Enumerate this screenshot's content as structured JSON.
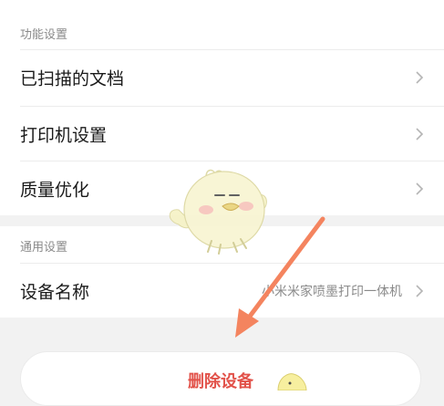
{
  "sections": {
    "function": {
      "title": "功能设置",
      "items": [
        {
          "label": "已扫描的文档"
        },
        {
          "label": "打印机设置"
        },
        {
          "label": "质量优化"
        }
      ]
    },
    "general": {
      "title": "通用设置",
      "items": [
        {
          "label": "设备名称",
          "value": "小米米家喷墨打印一体机"
        }
      ]
    }
  },
  "actions": {
    "delete_label": "删除设备"
  },
  "colors": {
    "accent_red": "#e2524a",
    "arrow_orange": "#f4845f",
    "background": "#f2f2f2"
  },
  "icons": {
    "row_chevron": "chevron-right-icon",
    "sticker": "chick-sticker",
    "annotation": "arrow-annotation"
  }
}
